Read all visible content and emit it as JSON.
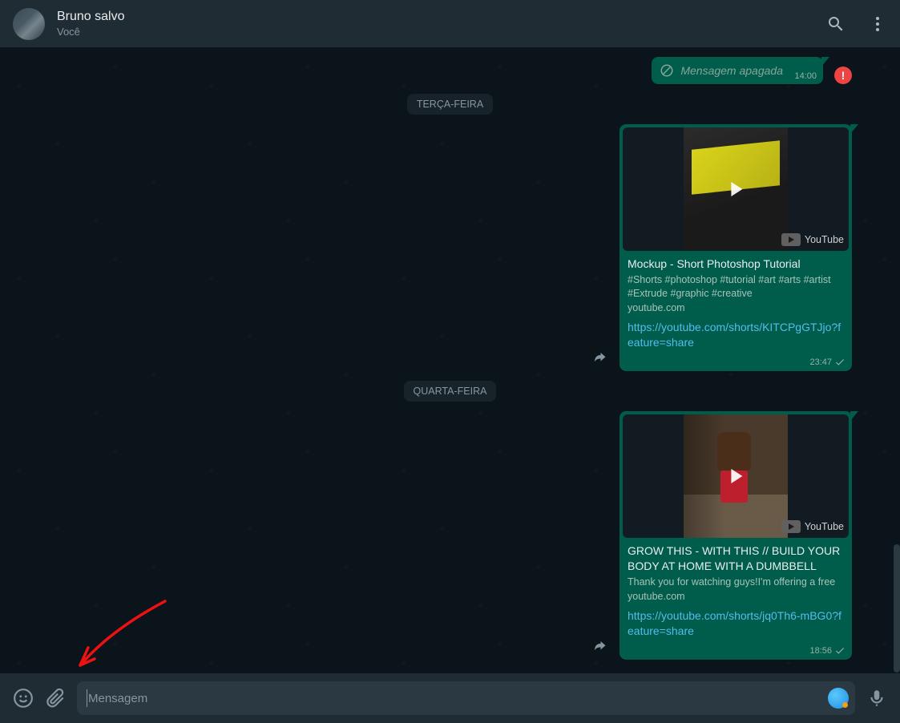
{
  "header": {
    "name": "Bruno salvo",
    "subtitle": "Você"
  },
  "dates": {
    "tuesday": "TERÇA-FEIRA",
    "wednesday": "QUARTA-FEIRA"
  },
  "deleted": {
    "text": "Mensagem apagada",
    "time": "14:00"
  },
  "msg1": {
    "title": "Mockup - Short Photoshop Tutorial",
    "desc": "#Shorts #photoshop #tutorial #art #arts #artist #Extrude #graphic #creative",
    "source": "youtube.com",
    "link": "https://youtube.com/shorts/KITCPgGTJjo?feature=share",
    "time": "23:47",
    "badge": "YouTube"
  },
  "msg2": {
    "title": "GROW THIS - WITH THIS // BUILD YOUR BODY AT HOME WITH A DUMBBELL",
    "desc": "Thank you for watching guys!I'm offering a free",
    "source": "youtube.com",
    "link": "https://youtube.com/shorts/jq0Th6-mBG0?feature=share",
    "time": "18:56",
    "badge": "YouTube"
  },
  "composer": {
    "placeholder": "Mensagem"
  }
}
